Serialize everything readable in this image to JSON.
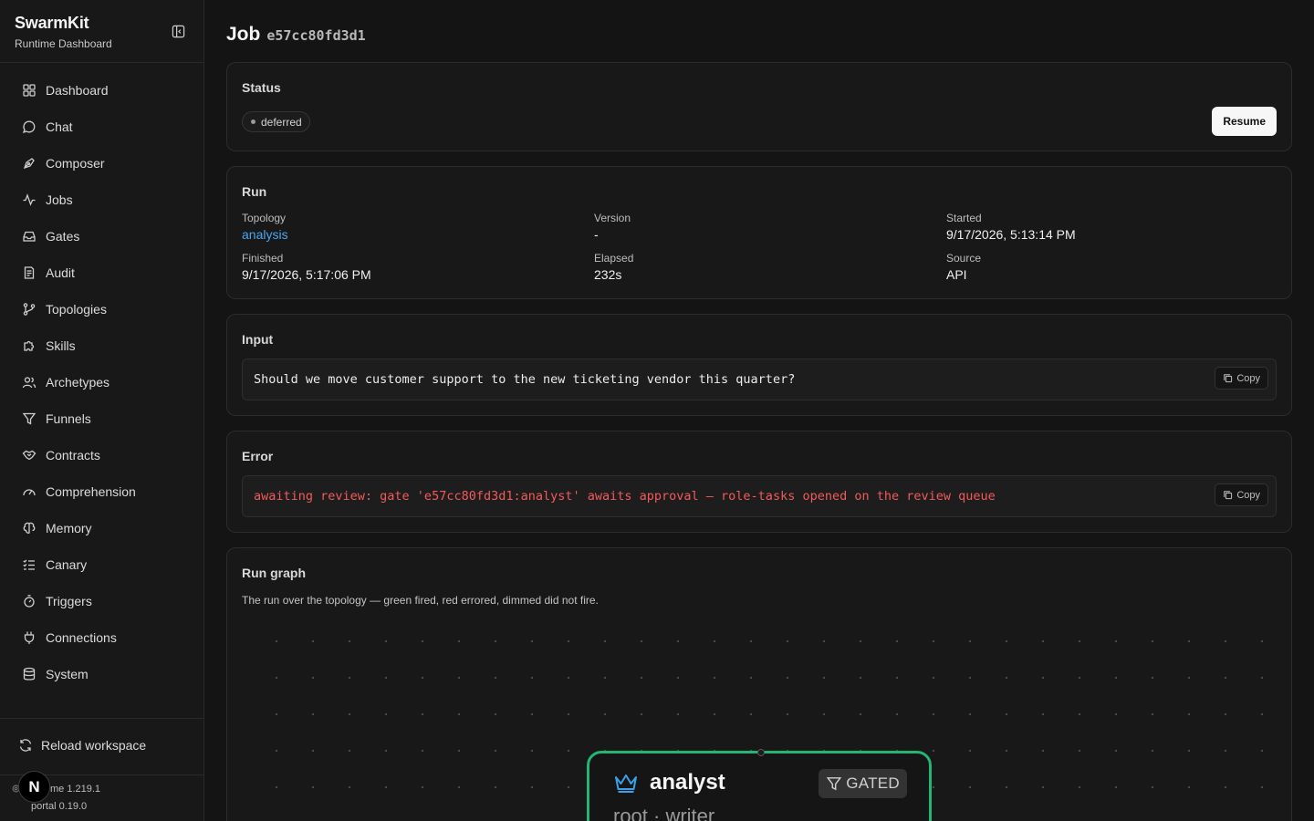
{
  "sidebar": {
    "app_name": "SwarmKit",
    "app_subtitle": "Runtime Dashboard",
    "items": [
      {
        "label": "Dashboard",
        "icon": "dashboard-icon"
      },
      {
        "label": "Chat",
        "icon": "chat-icon"
      },
      {
        "label": "Composer",
        "icon": "composer-icon"
      },
      {
        "label": "Jobs",
        "icon": "jobs-icon"
      },
      {
        "label": "Gates",
        "icon": "inbox-icon"
      },
      {
        "label": "Audit",
        "icon": "audit-icon"
      },
      {
        "label": "Topologies",
        "icon": "branch-icon"
      },
      {
        "label": "Skills",
        "icon": "puzzle-icon"
      },
      {
        "label": "Archetypes",
        "icon": "users-icon"
      },
      {
        "label": "Funnels",
        "icon": "funnel-icon"
      },
      {
        "label": "Contracts",
        "icon": "handshake-icon"
      },
      {
        "label": "Comprehension",
        "icon": "gauge-icon"
      },
      {
        "label": "Memory",
        "icon": "brain-icon"
      },
      {
        "label": "Canary",
        "icon": "checklist-icon"
      },
      {
        "label": "Triggers",
        "icon": "timer-icon"
      },
      {
        "label": "Connections",
        "icon": "plug-icon"
      },
      {
        "label": "System",
        "icon": "database-icon"
      }
    ],
    "reload_label": "Reload workspace",
    "runtime_version": "me 1.219.1",
    "portal_version": "portal 0.19.0",
    "avatar_letter": "N"
  },
  "header": {
    "title": "Job",
    "job_id": "e57cc80fd3d1"
  },
  "status_card": {
    "title": "Status",
    "status": "deferred",
    "resume_label": "Resume"
  },
  "run_card": {
    "title": "Run",
    "topology_label": "Topology",
    "topology_value": "analysis",
    "version_label": "Version",
    "version_value": "-",
    "started_label": "Started",
    "started_value": "9/17/2026, 5:13:14 PM",
    "finished_label": "Finished",
    "finished_value": "9/17/2026, 5:17:06 PM",
    "elapsed_label": "Elapsed",
    "elapsed_value": "232s",
    "source_label": "Source",
    "source_value": "API"
  },
  "input_card": {
    "title": "Input",
    "text": "Should we move customer support to the new ticketing vendor this quarter?",
    "copy_label": "Copy"
  },
  "error_card": {
    "title": "Error",
    "text": "awaiting review: gate 'e57cc80fd3d1:analyst' awaits approval — role-tasks opened on the review queue",
    "copy_label": "Copy"
  },
  "graph_card": {
    "title": "Run graph",
    "subtitle": "The run over the topology — green fired, red errored, dimmed did not fire.",
    "node": {
      "name": "analyst",
      "badge": "GATED",
      "subtitle": "root · writer",
      "status_color": "#22b573"
    }
  },
  "colors": {
    "accent_link": "#4aa6ee",
    "error_text": "#f25a5a",
    "fired_green": "#22b573"
  }
}
